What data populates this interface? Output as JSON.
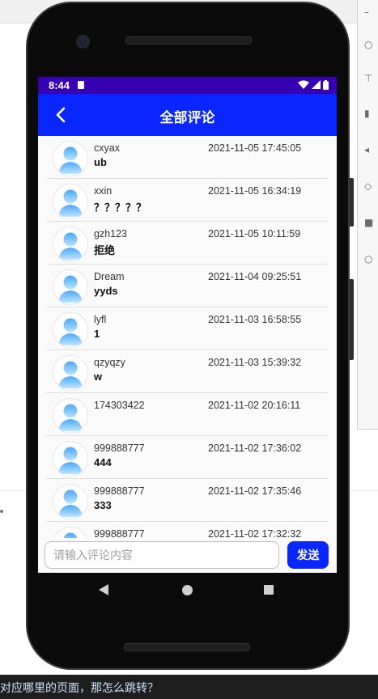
{
  "status_bar": {
    "time": "8:44"
  },
  "app_bar": {
    "title": "全部评论"
  },
  "comments": [
    {
      "user": "cxyax",
      "time": "2021-11-05 17:45:05",
      "text": "ub"
    },
    {
      "user": "xxin",
      "time": "2021-11-05 16:34:19",
      "text": "？？？？？"
    },
    {
      "user": "gzh123",
      "time": "2021-11-05 10:11:59",
      "text": "拒绝"
    },
    {
      "user": "Dream",
      "time": "2021-11-04 09:25:51",
      "text": "yyds"
    },
    {
      "user": "lyfl",
      "time": "2021-11-03 16:58:55",
      "text": "1"
    },
    {
      "user": "qzyqzy",
      "time": "2021-11-03 15:39:32",
      "text": "w"
    },
    {
      "user": "174303422",
      "time": "2021-11-02 20:16:11",
      "text": ""
    },
    {
      "user": "999888777",
      "time": "2021-11-02 17:36:02",
      "text": "444"
    },
    {
      "user": "999888777",
      "time": "2021-11-02 17:35:46",
      "text": "333"
    },
    {
      "user": "999888777",
      "time": "2021-11-02 17:32:32",
      "text": ""
    }
  ],
  "input_bar": {
    "placeholder": "请输入评论内容",
    "value": "",
    "send_label": "发送"
  },
  "background": {
    "bottom_text": "对应哪里的页面，那怎么跳转？"
  },
  "colors": {
    "app_bar": "#0a26ff",
    "status_bar": "#3700b3",
    "send_button": "#0a26ff"
  },
  "icons": {
    "back": "chevron-left-icon",
    "avatar": "user-avatar-icon",
    "wifi": "wifi-icon",
    "signal": "signal-icon",
    "battery": "battery-icon",
    "sim": "sim-card-icon"
  }
}
